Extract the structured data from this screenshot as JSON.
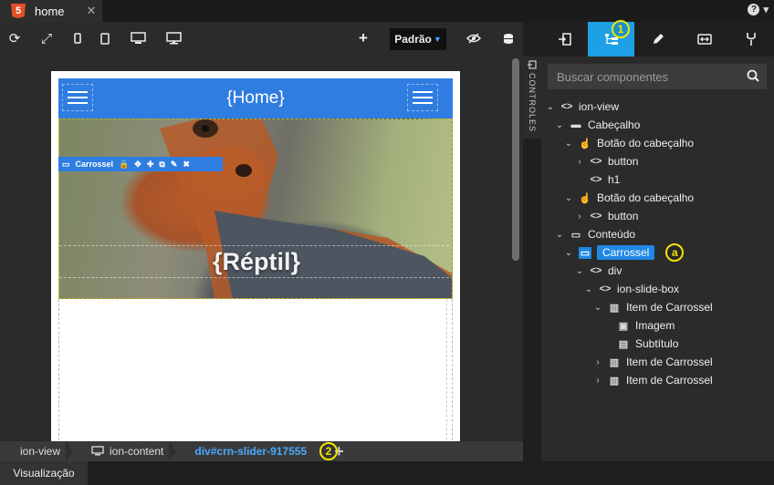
{
  "tab": {
    "label": "home",
    "badge": "5"
  },
  "window": {
    "help": "?",
    "pin": "▾"
  },
  "toolbar": {
    "preset": {
      "value": "Padrão"
    }
  },
  "app": {
    "title": "{Home}"
  },
  "carousel": {
    "subtitle": "{Réptil}"
  },
  "selection": {
    "label": "Carrossel"
  },
  "side_handle": {
    "label": "CONTROLES"
  },
  "breadcrumb": [
    {
      "label": "ion-view"
    },
    {
      "label": "ion-content"
    },
    {
      "label": "div#crn-slider-917555"
    }
  ],
  "status": {
    "tab_label": "Visualização"
  },
  "search": {
    "placeholder": "Buscar componentes"
  },
  "annotations": {
    "one": "1",
    "two": "2",
    "a": "a"
  },
  "tree": [
    {
      "label": "ion-view",
      "icon": "code-icon",
      "depth": 0,
      "expanded": true
    },
    {
      "label": "Cabeçalho",
      "icon": "header-icon",
      "depth": 1,
      "expanded": true
    },
    {
      "label": "Botão do cabeçalho",
      "icon": "touch-icon",
      "depth": 2,
      "expanded": true
    },
    {
      "label": "button",
      "icon": "code-icon",
      "depth": 3,
      "expanded": false
    },
    {
      "label": "h1",
      "icon": "code-icon",
      "depth": 3,
      "leaf": true
    },
    {
      "label": "Botão do cabeçalho",
      "icon": "touch-icon",
      "depth": 2,
      "expanded": true
    },
    {
      "label": "button",
      "icon": "code-icon",
      "depth": 3,
      "expanded": false
    },
    {
      "label": "Conteúdo",
      "icon": "monitor-icon",
      "depth": 1,
      "expanded": true
    },
    {
      "label": "Carrossel",
      "icon": "carousel-icon",
      "depth": 2,
      "expanded": true,
      "selected": true
    },
    {
      "label": "div",
      "icon": "code-icon",
      "depth": 3,
      "expanded": true
    },
    {
      "label": "ion-slide-box",
      "icon": "code-icon",
      "depth": 4,
      "expanded": true
    },
    {
      "label": "Item de Carrossel",
      "icon": "slide-icon",
      "depth": 5,
      "expanded": true
    },
    {
      "label": "Imagem",
      "icon": "image-icon",
      "depth": 6,
      "leaf": true
    },
    {
      "label": "Subtítulo",
      "icon": "subtitle-icon",
      "depth": 6,
      "leaf": true
    },
    {
      "label": "Item de Carrossel",
      "icon": "slide-icon",
      "depth": 5,
      "expanded": false
    },
    {
      "label": "Item de Carrossel",
      "icon": "slide-icon",
      "depth": 5,
      "expanded": false
    }
  ],
  "colors": {
    "accent": "#1ea0e4",
    "header": "#2f7de1",
    "annotation": "#f3e400"
  }
}
